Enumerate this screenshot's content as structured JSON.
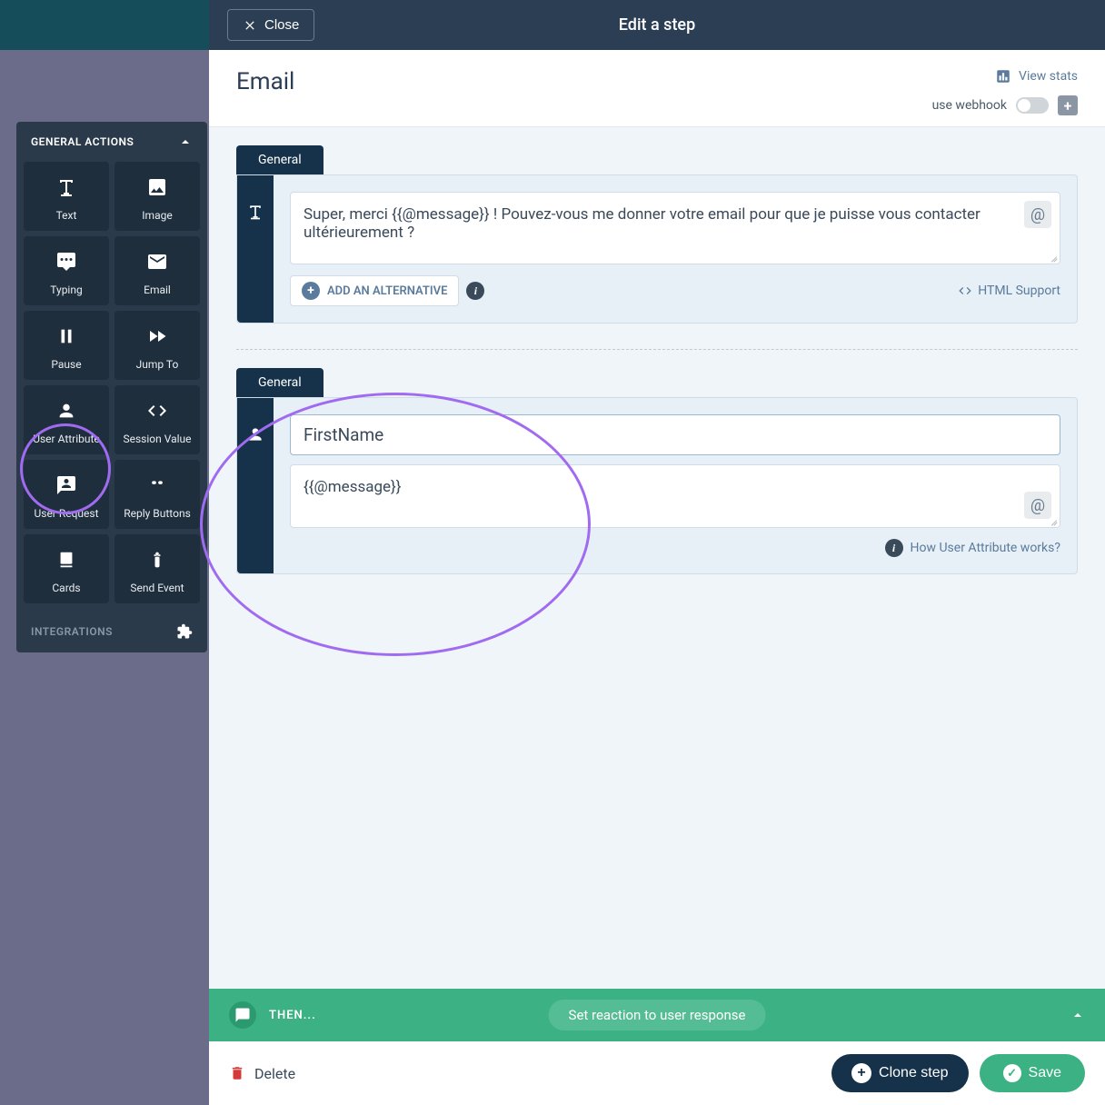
{
  "header": {
    "close_label": "Close",
    "title": "Edit a step"
  },
  "subheader": {
    "step_name": "Email",
    "view_stats_label": "View stats",
    "webhook_label": "use webhook"
  },
  "sidebar": {
    "section_title": "GENERAL ACTIONS",
    "footer_title": "INTEGRATIONS",
    "tiles": [
      {
        "label": "Text"
      },
      {
        "label": "Image"
      },
      {
        "label": "Typing"
      },
      {
        "label": "Email"
      },
      {
        "label": "Pause"
      },
      {
        "label": "Jump To"
      },
      {
        "label": "User Attribute"
      },
      {
        "label": "Session Value"
      },
      {
        "label": "User Request"
      },
      {
        "label": "Reply Buttons"
      },
      {
        "label": "Cards"
      },
      {
        "label": "Send Event"
      }
    ]
  },
  "block1": {
    "tab": "General",
    "text": "Super, merci {{@message}} ! Pouvez-vous me donner votre email pour que je puisse vous contacter ultérieurement ?",
    "add_alternative": "ADD AN ALTERNATIVE",
    "html_support": "HTML Support"
  },
  "block2": {
    "tab": "General",
    "attr_name": "FirstName",
    "attr_value": "{{@message}}",
    "help_label": "How User Attribute works?"
  },
  "then": {
    "label": "THEN...",
    "reaction": "Set reaction to user response"
  },
  "footer": {
    "delete_label": "Delete",
    "clone_label": "Clone step",
    "save_label": "Save"
  }
}
